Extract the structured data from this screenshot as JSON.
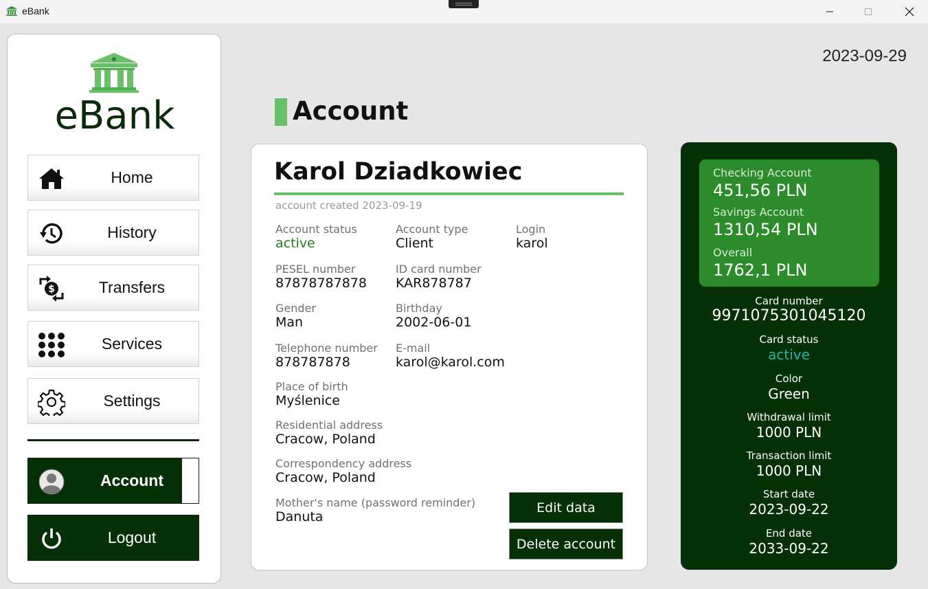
{
  "window": {
    "title": "eBank",
    "icon": "bank-icon"
  },
  "colors": {
    "accent_green": "#6abf69",
    "dark_green": "#063006",
    "balance_green": "#2c8c2c",
    "status_green": "#1e7e1e",
    "card_status_teal": "#2fb0a0"
  },
  "sidebar": {
    "logo_text": "eBank",
    "items": [
      {
        "label": "Home",
        "icon": "home-icon"
      },
      {
        "label": "History",
        "icon": "history-icon"
      },
      {
        "label": "Transfers",
        "icon": "transfer-dollar-icon"
      },
      {
        "label": "Services",
        "icon": "grid-dots-icon"
      },
      {
        "label": "Settings",
        "icon": "gear-icon"
      }
    ],
    "account": {
      "label": "Account",
      "icon": "user-avatar-icon"
    },
    "logout": {
      "label": "Logout",
      "icon": "power-icon"
    }
  },
  "header": {
    "date": "2023-09-29",
    "page_title": "Account"
  },
  "profile": {
    "name": "Karol Dziadkowiec",
    "created": "account created 2023-09-19",
    "fields": {
      "account_status": {
        "label": "Account status",
        "value": "active"
      },
      "account_type": {
        "label": "Account type",
        "value": "Client"
      },
      "login": {
        "label": "Login",
        "value": "karol"
      },
      "pesel": {
        "label": "PESEL number",
        "value": "87878787878"
      },
      "id_card": {
        "label": "ID card number",
        "value": "KAR878787"
      },
      "gender": {
        "label": "Gender",
        "value": "Man"
      },
      "birthday": {
        "label": "Birthday",
        "value": "2002-06-01"
      },
      "telephone": {
        "label": "Telephone number",
        "value": "878787878"
      },
      "email": {
        "label": "E-mail",
        "value": "karol@karol.com"
      },
      "place_of_birth": {
        "label": "Place of birth",
        "value": "Myślenice"
      },
      "residential": {
        "label": "Residential address",
        "value": "Cracow, Poland"
      },
      "correspondency": {
        "label": "Correspondency address",
        "value": "Cracow, Poland"
      },
      "mothers_name": {
        "label": "Mother's name (password reminder)",
        "value": "Danuta"
      }
    },
    "edit_label": "Edit data",
    "delete_label": "Delete account"
  },
  "balances": {
    "checking": {
      "label": "Checking Account",
      "value": "451,56 PLN"
    },
    "savings": {
      "label": "Savings Account",
      "value": "1310,54 PLN"
    },
    "overall": {
      "label": "Overall",
      "value": "1762,1 PLN"
    }
  },
  "card": {
    "number": {
      "label": "Card number",
      "value": "9971075301045120"
    },
    "status": {
      "label": "Card status",
      "value": "active"
    },
    "color": {
      "label": "Color",
      "value": "Green"
    },
    "withdrawal_limit": {
      "label": "Withdrawal limit",
      "value": "1000 PLN"
    },
    "transaction_limit": {
      "label": "Transaction limit",
      "value": "1000 PLN"
    },
    "start_date": {
      "label": "Start date",
      "value": "2023-09-22"
    },
    "end_date": {
      "label": "End date",
      "value": "2033-09-22"
    }
  }
}
